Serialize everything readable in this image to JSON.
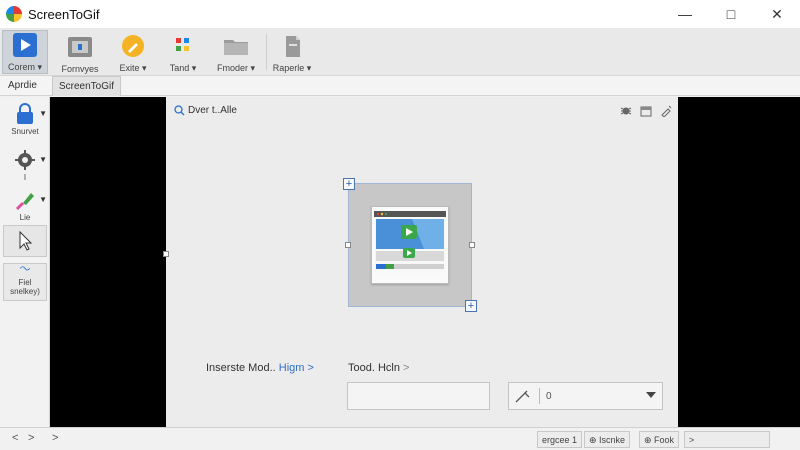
{
  "window": {
    "title": "ScreenToGif",
    "minimize_glyph": "—",
    "maximize_glyph": "□",
    "close_glyph": "✕"
  },
  "ribbon": {
    "buttons": [
      {
        "label": "Corem ▾",
        "icon": "play-icon",
        "active": true
      },
      {
        "label": "Fornvyes",
        "icon": "film-icon"
      },
      {
        "label": "Exite ▾",
        "icon": "edit-icon"
      },
      {
        "label": "Tand ▾",
        "icon": "apps-icon"
      },
      {
        "label": "Fmoder ▾",
        "icon": "folder-icon"
      },
      {
        "label": "Raperle ▾",
        "icon": "document-icon"
      }
    ]
  },
  "tabs": [
    {
      "label": "Aprdie"
    },
    {
      "label": "ScreenToGif",
      "active": true
    }
  ],
  "left_tools": [
    {
      "label": "Snurvet",
      "icon": "lock-icon"
    },
    {
      "label": "I",
      "icon": "gear-icon"
    },
    {
      "label": "Lie",
      "icon": "brush-icon"
    },
    {
      "label": "",
      "icon": "cursor-icon"
    },
    {
      "label": "Fiel\nsnelkey)",
      "icon": "wave-icon"
    }
  ],
  "canvas": {
    "title": "Dver t..Alle",
    "toolbar_icons": [
      "bug-icon",
      "calendar-icon",
      "edit-icon"
    ],
    "mode_label": "Inserste Mod..",
    "mode_link": "Higm >",
    "tool_label": "Tood. Hcln",
    "tool_arrow": ">",
    "select_value": "0"
  },
  "statusbar": {
    "nav_left": "<",
    "nav_right": ">",
    "nav_expand": ">",
    "item1": "ergcee 1",
    "item2": "⊕ Iscnke",
    "item3": "⊕ Fook",
    "item4": ">"
  },
  "colors": {
    "accent": "#2f6fc4",
    "frame_border": "#4a74b0",
    "canvas_bg": "#ececec",
    "stage_bg": "#000000"
  }
}
